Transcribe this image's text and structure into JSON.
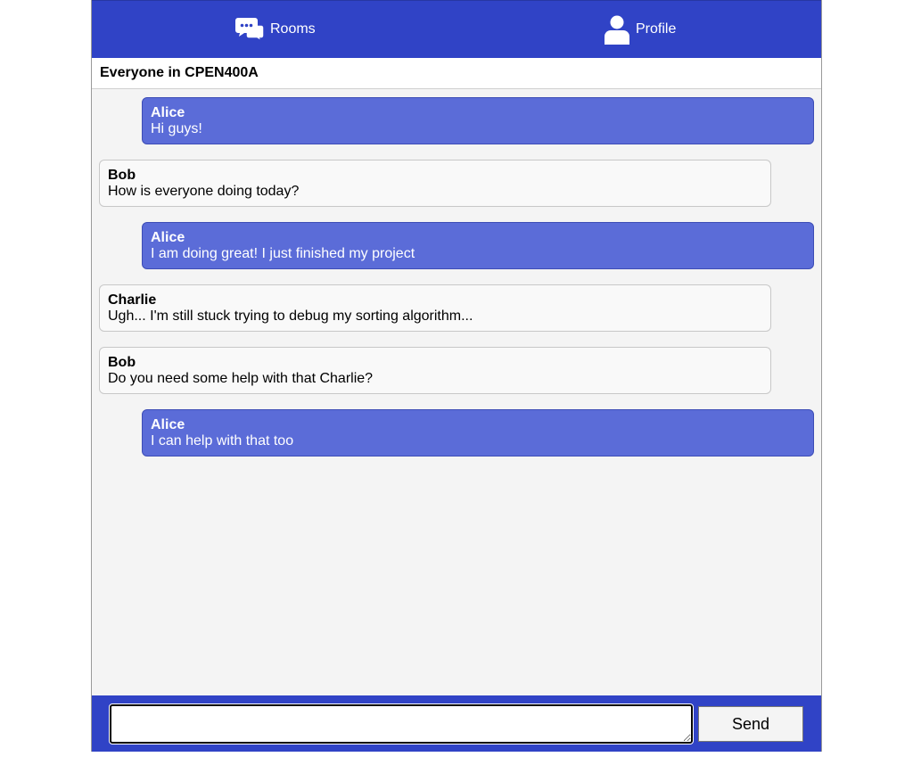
{
  "nav": {
    "rooms_label": "Rooms",
    "profile_label": "Profile",
    "rooms_icon": "chat-bubbles-icon",
    "profile_icon": "user-icon"
  },
  "room": {
    "title": "Everyone in CPEN400A"
  },
  "messages": [
    {
      "user": "Alice",
      "text": "Hi guys!",
      "mine": true
    },
    {
      "user": "Bob",
      "text": "How is everyone doing today?",
      "mine": false
    },
    {
      "user": "Alice",
      "text": "I am doing great! I just finished my project",
      "mine": true
    },
    {
      "user": "Charlie",
      "text": "Ugh... I'm still stuck trying to debug my sorting algorithm...",
      "mine": false
    },
    {
      "user": "Bob",
      "text": "Do you need some help with that Charlie?",
      "mine": false
    },
    {
      "user": "Alice",
      "text": "I can help with that too",
      "mine": true
    }
  ],
  "composer": {
    "value": "",
    "send_label": "Send"
  },
  "colors": {
    "header": "#3043c6",
    "my_message": "#5b6cd8",
    "other_message": "#f9f9f9",
    "chat_background": "#f4f4f4"
  }
}
